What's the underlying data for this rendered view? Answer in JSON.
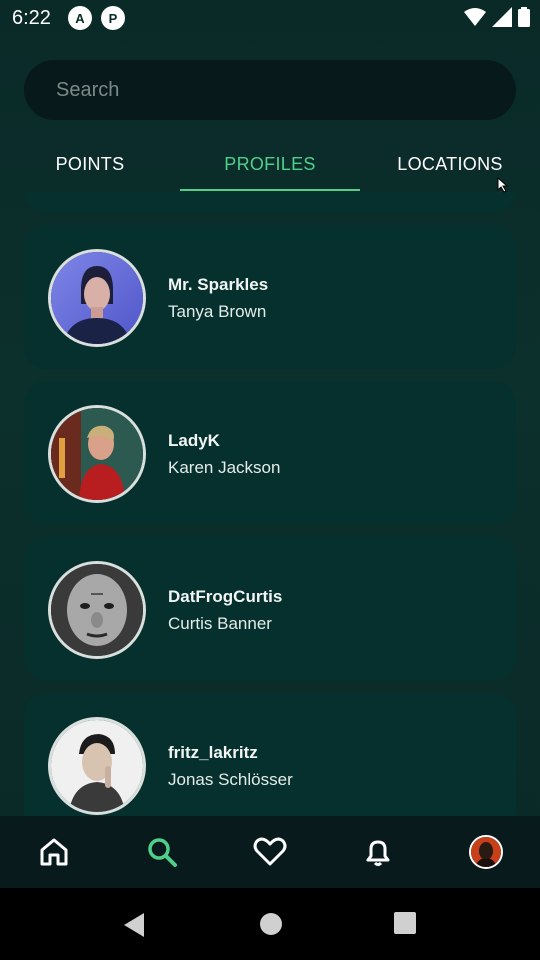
{
  "status_bar": {
    "time": "6:22",
    "app_icons": [
      "A",
      "P"
    ]
  },
  "search": {
    "placeholder": "Search",
    "value": ""
  },
  "tabs": [
    {
      "label": "POINTS",
      "active": false
    },
    {
      "label": "PROFILES",
      "active": true
    },
    {
      "label": "LOCATIONS",
      "active": false
    }
  ],
  "profiles": [
    {
      "username": "Mr. Sparkles",
      "name": "Tanya Brown",
      "avatar": "woman-blue-portrait"
    },
    {
      "username": "LadyK",
      "name": "Karen Jackson",
      "avatar": "woman-red-portrait"
    },
    {
      "username": "DatFrogCurtis",
      "name": "Curtis Banner",
      "avatar": "man-bw-portrait"
    },
    {
      "username": "fritz_lakritz",
      "name": "Jonas Schlösser",
      "avatar": "man-thinking-portrait"
    }
  ],
  "bottom_nav": [
    {
      "name": "home",
      "icon": "home-icon",
      "active": false
    },
    {
      "name": "search",
      "icon": "search-icon",
      "active": true
    },
    {
      "name": "favorites",
      "icon": "heart-icon",
      "active": false
    },
    {
      "name": "notifications",
      "icon": "bell-icon",
      "active": false
    },
    {
      "name": "profile",
      "icon": "avatar",
      "active": false
    }
  ],
  "colors": {
    "accent": "#4fcf8a",
    "card": "#06302d",
    "background": "#0a2a28"
  }
}
